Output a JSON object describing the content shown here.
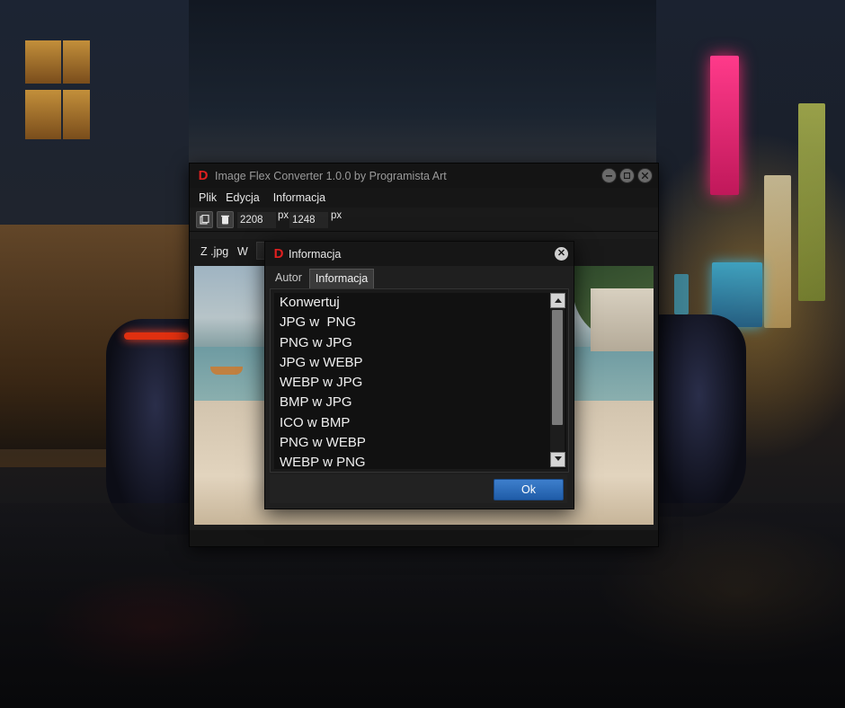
{
  "app": {
    "title": "Image Flex Converter 1.0.0 by Programista Art",
    "logo_letter": "D",
    "logo_color": "#e02020",
    "menu": [
      "Plik",
      "Edycja",
      "Informacja"
    ],
    "toolbar": {
      "width_value": "2208",
      "height_value": "1248",
      "unit": "px",
      "icons": [
        "paste-icon",
        "delete-icon"
      ]
    },
    "convert_row": {
      "from_label": "Z .jpg",
      "to_label": "W"
    }
  },
  "dialog": {
    "title": "Informacja",
    "logo_letter": "D",
    "close_glyph": "✕",
    "tabs": [
      {
        "label": "Autor",
        "active": false
      },
      {
        "label": "Informacja",
        "active": true
      }
    ],
    "list_items": [
      "Konwertuj",
      "JPG w  PNG",
      "PNG w JPG",
      "JPG w WEBP",
      "WEBP w JPG",
      "BMP w JPG",
      "ICO w BMP",
      "PNG w WEBP",
      "WEBP w PNG"
    ],
    "ok_label": "Ok",
    "ok_color": "#2d6fc0"
  },
  "background": {
    "description_colors": {
      "warm": "#e0a23c",
      "neon_pink": "#e02a6a",
      "neon_cyan": "#3ab0d8"
    }
  }
}
